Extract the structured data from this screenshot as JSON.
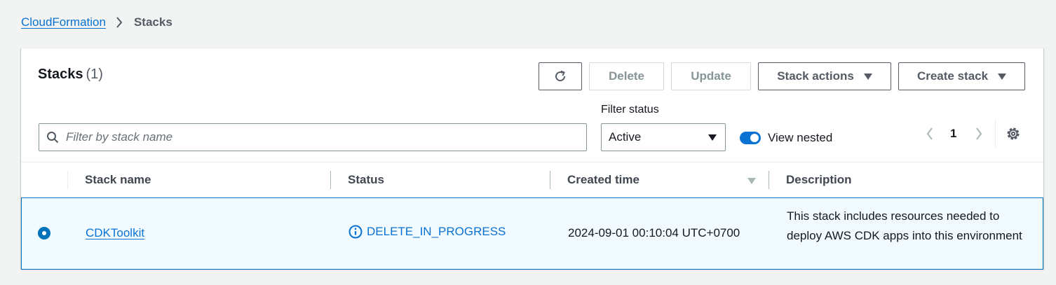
{
  "breadcrumb": {
    "parent": "CloudFormation",
    "current": "Stacks"
  },
  "header": {
    "title": "Stacks",
    "count": "(1)"
  },
  "toolbar": {
    "delete_label": "Delete",
    "update_label": "Update",
    "stack_actions_label": "Stack actions",
    "create_stack_label": "Create stack"
  },
  "filters": {
    "search_placeholder": "Filter by stack name",
    "search_value": "",
    "status_label": "Filter status",
    "status_value": "Active",
    "view_nested_label": "View nested",
    "view_nested_on": true
  },
  "pagination": {
    "current_page": "1"
  },
  "table": {
    "columns": [
      "Stack name",
      "Status",
      "Created time",
      "Description"
    ],
    "rows": [
      {
        "selected": true,
        "stack_name": "CDKToolkit",
        "status": "DELETE_IN_PROGRESS",
        "created_time": "2024-09-01 00:10:04 UTC+0700",
        "description": "This stack includes resources needed to deploy AWS CDK apps into this environment"
      }
    ]
  },
  "colors": {
    "link": "#0972d3",
    "selected_row_bg": "#f1faff",
    "selected_row_border": "#0073bb",
    "toggle_on": "#0972d3"
  },
  "icons": [
    "chevron-right-icon",
    "refresh-icon",
    "caret-down-icon",
    "search-icon",
    "chevron-left-icon",
    "settings-icon",
    "info-icon",
    "sort-descending-icon"
  ]
}
